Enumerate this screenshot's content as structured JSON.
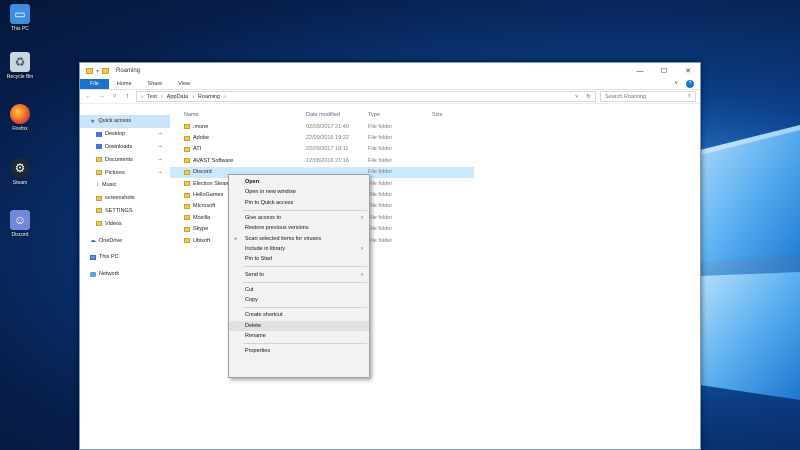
{
  "desktop": {
    "icons": [
      {
        "label": "This PC",
        "icon": "computer-icon"
      },
      {
        "label": "Recycle Bin",
        "icon": "recycle-bin-icon"
      },
      {
        "label": "Firefox",
        "icon": "firefox-icon"
      },
      {
        "label": "Steam",
        "icon": "steam-icon"
      },
      {
        "label": "Discord",
        "icon": "discord-icon"
      }
    ]
  },
  "window": {
    "title": "Roaming",
    "controls": {
      "minimize": "—",
      "maximize": "☐",
      "close": "✕"
    }
  },
  "ribbon": {
    "tabs": [
      "File",
      "Home",
      "Share",
      "View"
    ],
    "expand": "˅",
    "help": "?"
  },
  "address": {
    "back": "←",
    "forward": "→",
    "recent": "˅",
    "up": "↑",
    "crumbs": [
      "Test",
      "AppData",
      "Roaming"
    ],
    "dropdown": "˅",
    "refresh": "↻",
    "search_placeholder": "Search Roaming",
    "search_icon": "⌕"
  },
  "navpane": {
    "items": [
      {
        "label": "Quick access",
        "icon": "star"
      },
      {
        "label": "Desktop",
        "icon": "blue",
        "pinned": true
      },
      {
        "label": "Downloads",
        "icon": "blue",
        "pinned": true
      },
      {
        "label": "Documents",
        "icon": "folder",
        "pinned": true
      },
      {
        "label": "Pictures",
        "icon": "folder",
        "pinned": true
      },
      {
        "label": "Music",
        "icon": "music"
      },
      {
        "label": "screenshots",
        "icon": "folder"
      },
      {
        "label": "SETTINGS",
        "icon": "folder"
      },
      {
        "label": "Videos",
        "icon": "folder"
      },
      {
        "label": "OneDrive",
        "icon": "cloud"
      },
      {
        "label": "This PC",
        "icon": "pc"
      },
      {
        "label": "Network",
        "icon": "net"
      }
    ],
    "pin_glyph": "⊸"
  },
  "filelist": {
    "columns": {
      "name": "Name",
      "date": "Date modified",
      "type": "Type",
      "size": "Size"
    },
    "rows": [
      {
        "name": ".mone",
        "date": "02/09/2017 21:40",
        "type": "File folder"
      },
      {
        "name": "Adobe",
        "date": "22/09/2016 19:22",
        "type": "File folder"
      },
      {
        "name": "ATI",
        "date": "22/09/2017 18:11",
        "type": "File folder"
      },
      {
        "name": "AVAST Software",
        "date": "12/08/2016 21:16",
        "type": "File folder"
      },
      {
        "name": "Discord",
        "date": "",
        "type": "File folder"
      },
      {
        "name": "Election Steam",
        "date": "",
        "type": "File folder"
      },
      {
        "name": "HelloGames",
        "date": "",
        "type": "File folder"
      },
      {
        "name": "Microsoft",
        "date": "",
        "type": "File folder"
      },
      {
        "name": "Mozilla",
        "date": "",
        "type": "File folder"
      },
      {
        "name": "Skype",
        "date": "",
        "type": "File folder"
      },
      {
        "name": "Ubisoft",
        "date": "",
        "type": "File folder"
      }
    ]
  },
  "context_menu": {
    "groups": [
      [
        {
          "label": "Open",
          "bold": true
        },
        {
          "label": "Open in new window"
        },
        {
          "label": "Pin to Quick access"
        }
      ],
      [
        {
          "label": "Give access to",
          "submenu": true
        },
        {
          "label": "Restore previous versions"
        },
        {
          "label": "Scan selected items for viruses",
          "lead": true
        },
        {
          "label": "Include in library",
          "submenu": true
        },
        {
          "label": "Pin to Start"
        }
      ],
      [
        {
          "label": "Send to",
          "submenu": true
        }
      ],
      [
        {
          "label": "Cut"
        },
        {
          "label": "Copy"
        }
      ],
      [
        {
          "label": "Create shortcut"
        },
        {
          "label": "Delete",
          "highlight": true
        },
        {
          "label": "Rename"
        }
      ],
      [
        {
          "label": "Properties"
        }
      ]
    ],
    "submenu_glyph": "›",
    "lead_glyph": "●"
  }
}
